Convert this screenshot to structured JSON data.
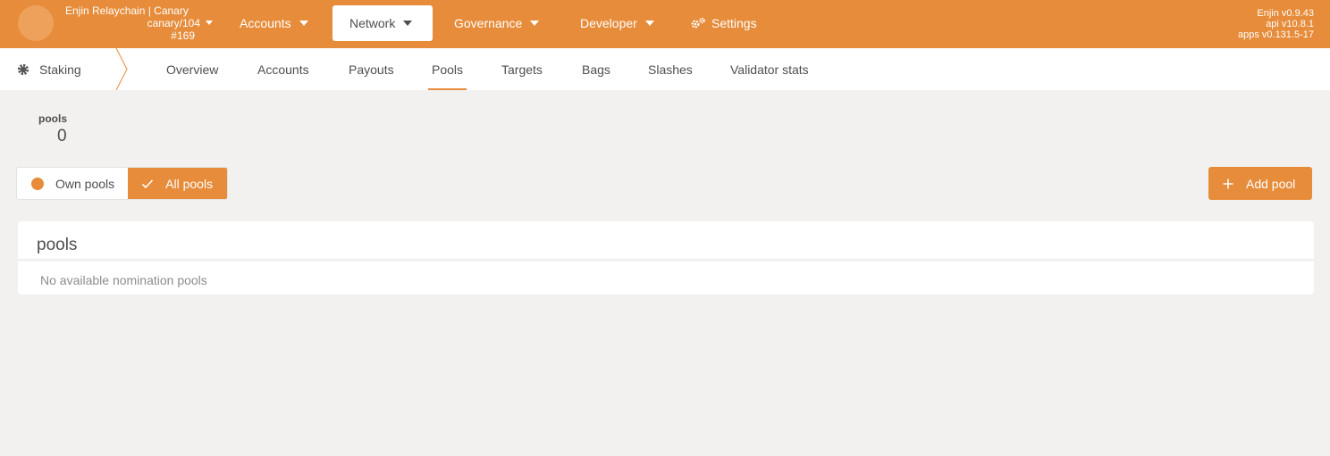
{
  "header": {
    "chain_name": "Enjin Relaychain | Canary",
    "chain_spec": "canary/104",
    "block": "#169",
    "nav": [
      {
        "label": "Accounts"
      },
      {
        "label": "Network"
      },
      {
        "label": "Governance"
      },
      {
        "label": "Developer"
      },
      {
        "label": "Settings"
      }
    ],
    "versions": {
      "node": "Enjin v0.9.43",
      "api": "api v10.8.1",
      "apps": "apps v0.131.5-17"
    }
  },
  "subnav": {
    "section": "Staking",
    "tabs": [
      {
        "label": "Overview"
      },
      {
        "label": "Accounts"
      },
      {
        "label": "Payouts"
      },
      {
        "label": "Pools"
      },
      {
        "label": "Targets"
      },
      {
        "label": "Bags"
      },
      {
        "label": "Slashes"
      },
      {
        "label": "Validator stats"
      }
    ],
    "active_tab": "Pools"
  },
  "summary": {
    "label": "pools",
    "value": "0"
  },
  "filter": {
    "own_label": "Own pools",
    "all_label": "All pools",
    "selected": "All pools"
  },
  "actions": {
    "add_pool": "Add pool"
  },
  "table": {
    "title": "pools",
    "empty_message": "No available nomination pools"
  },
  "colors": {
    "accent": "#e68c3a",
    "background": "#f2f1ef"
  },
  "icons": [
    "caret-down-icon",
    "gear-icon",
    "cog-icon",
    "check-icon",
    "plus-icon",
    "chevron-right-icon"
  ]
}
